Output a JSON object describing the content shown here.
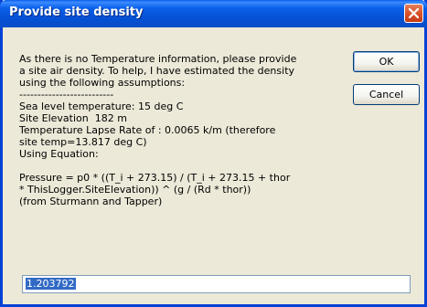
{
  "dialog": {
    "title": "Provide site density",
    "message": "As there is no Temperature information, please provide\na site air density. To help, I have estimated the density\nusing the following assumptions:\n--------------------------\nSea level temperature: 15 deg C\nSite Elevation  182 m\nTemperature Lapse Rate of : 0.0065 k/m (therefore\nsite temp=13.817 deg C)\nUsing Equation:\n\nPressure = p0 * ((T_i + 273.15) / (T_i + 273.15 + thor\n* ThisLogger.SiteElevation)) ^ (g / (Rd * thor))\n(from Sturmann and Tapper)",
    "ok_label": "OK",
    "cancel_label": "Cancel",
    "input_value": "1.203792",
    "close_icon": "close-icon"
  }
}
